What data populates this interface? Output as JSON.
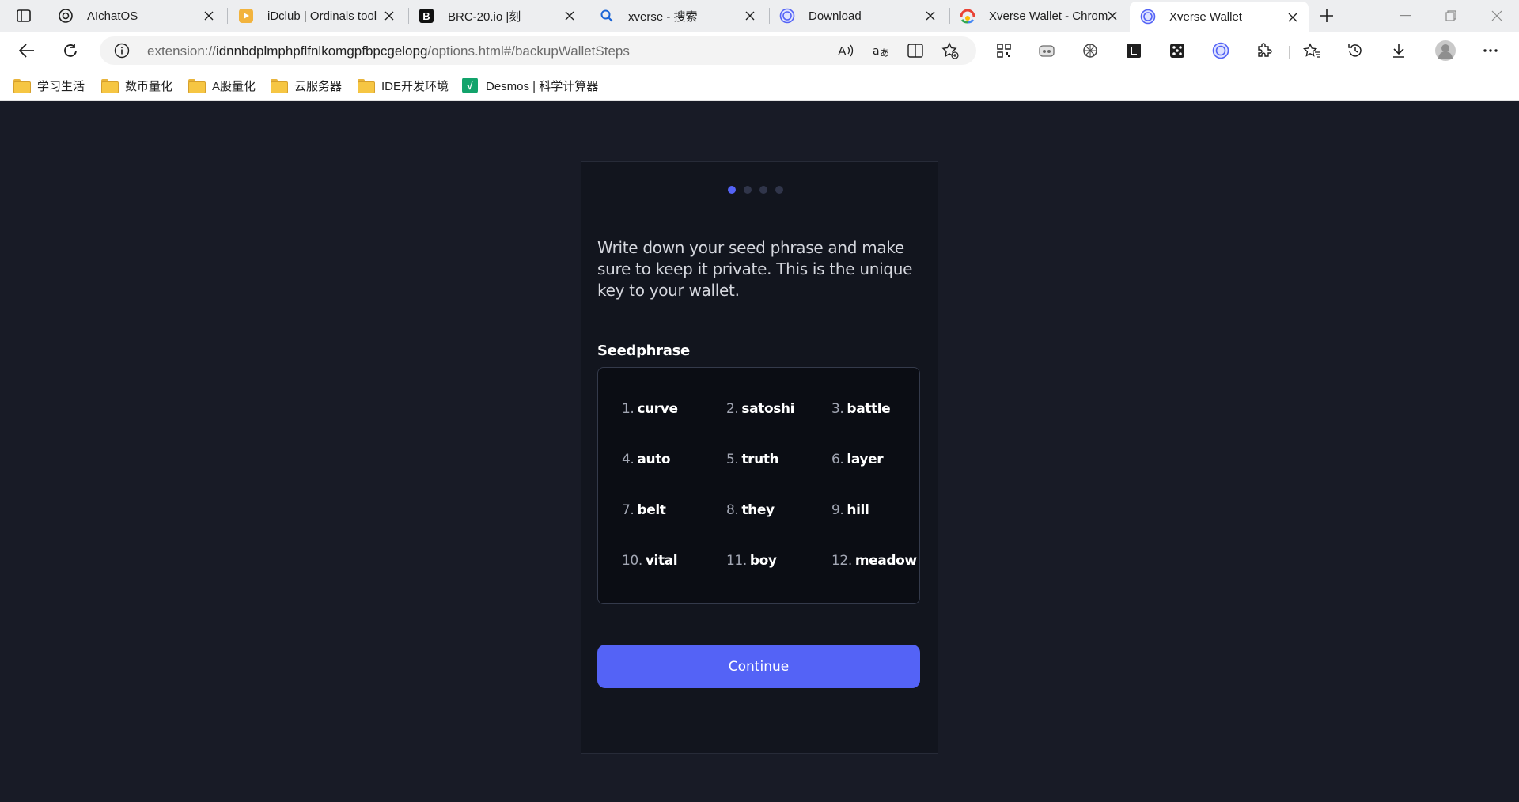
{
  "browser": {
    "tabs": [
      {
        "title": "AIchatOS",
        "icon": "openai-icon"
      },
      {
        "title": "iDclub | Ordinals tool",
        "icon": "idclub-icon"
      },
      {
        "title": "BRC-20.io |刻",
        "icon": "brc20-icon"
      },
      {
        "title": "xverse - 搜索",
        "icon": "search-icon"
      },
      {
        "title": "Download",
        "icon": "xverse-icon"
      },
      {
        "title": "Xverse Wallet - Chrom",
        "icon": "chrome-store-icon"
      },
      {
        "title": "Xverse Wallet",
        "icon": "xverse-icon"
      }
    ],
    "active_tab": 6,
    "url_prefix": "extension://",
    "url_host": "idnnbdplmphpflfnlkomgpfbpcgelopg",
    "url_path": "/options.html#/backupWalletSteps",
    "bookmarks": [
      {
        "label": "学习生活",
        "icon": "folder-icon"
      },
      {
        "label": "数币量化",
        "icon": "folder-icon"
      },
      {
        "label": "A股量化",
        "icon": "folder-icon"
      },
      {
        "label": "云服务器",
        "icon": "folder-icon"
      },
      {
        "label": "IDE开发环境",
        "icon": "folder-icon"
      },
      {
        "label": "Desmos | 科学计算器",
        "icon": "desmos-icon"
      }
    ]
  },
  "wallet": {
    "steps_total": 4,
    "step_active": 1,
    "instruction": "Write down your seed phrase and make sure to keep it private. This is the unique key to your wallet.",
    "seed_label": "Seedphrase",
    "seed_words": [
      {
        "num": "1.",
        "word": "curve"
      },
      {
        "num": "2.",
        "word": "satoshi"
      },
      {
        "num": "3.",
        "word": "battle"
      },
      {
        "num": "4.",
        "word": "auto"
      },
      {
        "num": "5.",
        "word": "truth"
      },
      {
        "num": "6.",
        "word": "layer"
      },
      {
        "num": "7.",
        "word": "belt"
      },
      {
        "num": "8.",
        "word": "they"
      },
      {
        "num": "9.",
        "word": "hill"
      },
      {
        "num": "10.",
        "word": "vital"
      },
      {
        "num": "11.",
        "word": "boy"
      },
      {
        "num": "12.",
        "word": "meadow"
      }
    ],
    "continue_label": "Continue"
  },
  "colors": {
    "accent": "#5463f6",
    "page_bg": "#181b26",
    "panel_bg": "#12151e"
  }
}
